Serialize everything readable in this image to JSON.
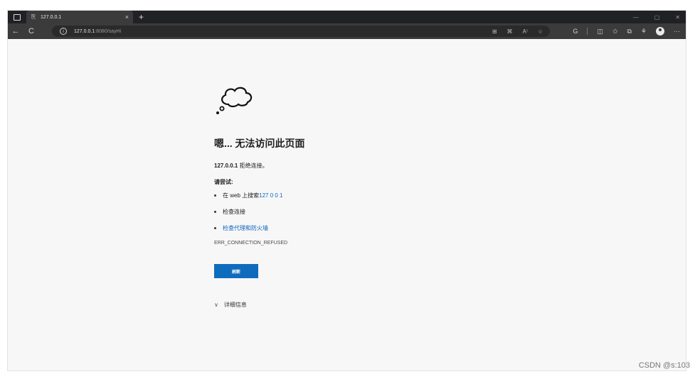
{
  "browser": {
    "tab": {
      "title": "127.0.0.1",
      "close": "×"
    },
    "new_tab": "+",
    "window": {
      "minimize": "—",
      "restore": "▢",
      "close": "✕"
    },
    "url": {
      "host": "127.0.0.1",
      "rest": ":8080/sayHi"
    },
    "icons": {
      "tab_manager": "tab-manager-icon",
      "favicon": "page-icon",
      "back": "back-arrow-icon",
      "refresh": "refresh-icon",
      "info": "info-icon",
      "app": "app-available-icon",
      "grid": "grid-icon",
      "read_aloud": "read-aloud-icon",
      "favorite": "favorite-star-icon",
      "copilot": "copilot-icon",
      "split": "split-screen-icon",
      "favorites_list": "favorites-list-icon",
      "collections": "collections-icon",
      "extensions": "extensions-icon",
      "profile": "profile-avatar-icon",
      "more": "more-menu-icon"
    },
    "glyphs": {
      "back": "←",
      "refresh": "C",
      "info": "i",
      "app": "⊞",
      "grid": "⌘",
      "read_aloud": "A⁾",
      "favorite": "☆",
      "copilot": "G",
      "split": "◫",
      "favorites_list": "✩",
      "collections": "⧉",
      "extensions": "⚘",
      "more": "···"
    }
  },
  "error_page": {
    "heading": "嗯... 无法访问此页面",
    "host": "127.0.0.1",
    "host_suffix": " 拒绝连接。",
    "try_label": "请尝试:",
    "suggestions": [
      {
        "prefix": "在 web 上搜索 ",
        "link": "127 0 0 1"
      },
      {
        "prefix": "检查连接",
        "link": ""
      },
      {
        "prefix": "",
        "link": "检查代理和防火墙"
      }
    ],
    "error_code": "ERR_CONNECTION_REFUSED",
    "refresh_button": "刷新",
    "details_chevron": "∨",
    "details_label": "详细信息"
  },
  "watermark": "CSDN @s:103",
  "colors": {
    "accent": "#0f6cbd",
    "link": "#0e63c0",
    "titlebar": "#202124",
    "toolbar": "#3b3b3b"
  }
}
